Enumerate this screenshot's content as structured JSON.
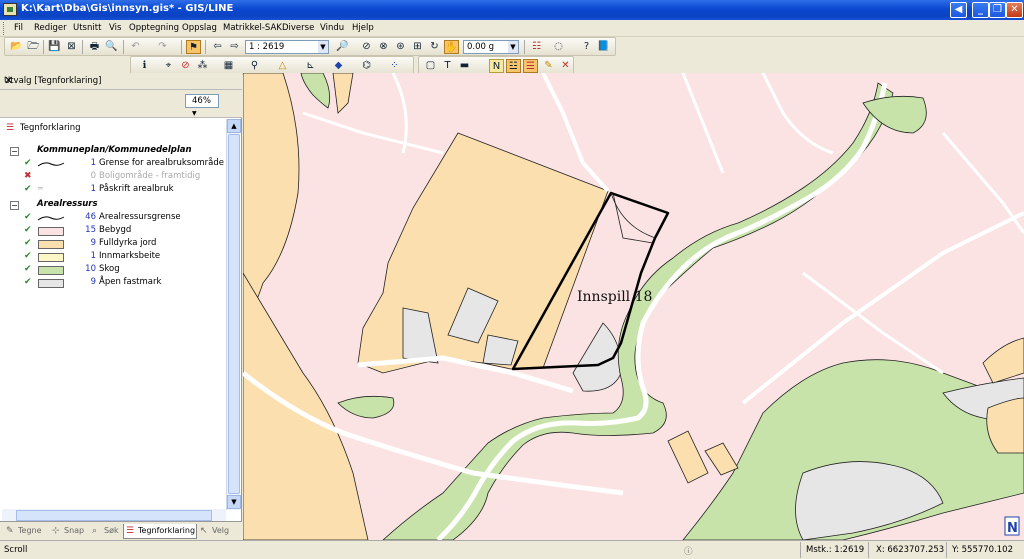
{
  "window": {
    "title": "K:\\Kart\\Dba\\Gis\\innsyn.gis* - GIS/LINE"
  },
  "menu": [
    "Fil",
    "Rediger",
    "Utsnitt",
    "Vis",
    "Opptegning",
    "Oppslag",
    "Matrikkel-SAK",
    "Diverse",
    "Vindu",
    "Hjelp"
  ],
  "toolbar": {
    "scale": "1 : 2619",
    "angle": "0.00 g"
  },
  "panel": {
    "title": "Utvalg [Tegnforklaring]",
    "zoom": "46%",
    "root_label": "Tegnforklaring"
  },
  "legend": {
    "groups": [
      {
        "name": "Kommuneplan/Kommunedelplan",
        "items": [
          {
            "count": "1",
            "label": "Grense for arealbruksområde",
            "swatch": "line",
            "visible": true
          },
          {
            "count": "0",
            "label": "Boligområde - framtidig",
            "swatch": "none",
            "visible": false
          },
          {
            "count": "1",
            "label": "Påskrift arealbruk",
            "swatch": "text",
            "visible": true
          }
        ]
      },
      {
        "name": "Arealressurs",
        "items": [
          {
            "count": "46",
            "label": "Arealressursgrense",
            "swatch": "line",
            "visible": true
          },
          {
            "count": "15",
            "label": "Bebygd",
            "swatch": "#fbe3e3",
            "visible": true
          },
          {
            "count": "9",
            "label": "Fulldyrka jord",
            "swatch": "#fbdfae",
            "visible": true
          },
          {
            "count": "1",
            "label": "Innmarksbeite",
            "swatch": "#fdf6c6",
            "visible": true
          },
          {
            "count": "10",
            "label": "Skog",
            "swatch": "#c8e3a9",
            "visible": true
          },
          {
            "count": "9",
            "label": "Åpen fastmark",
            "swatch": "#e6e6e6",
            "visible": true
          }
        ]
      }
    ]
  },
  "tabs": [
    {
      "label": "Tegne",
      "active": false
    },
    {
      "label": "Snap",
      "active": false
    },
    {
      "label": "Søk",
      "active": false
    },
    {
      "label": "Tegnforklaring",
      "active": true
    },
    {
      "label": "Velg",
      "active": false
    }
  ],
  "map": {
    "annotation": "Innspill 18",
    "colors": {
      "bebygd": "#fbe3e3",
      "fulldyrka": "#fbdfae",
      "skog": "#c8e3a9",
      "aapen": "#e6e6e6"
    }
  },
  "status": {
    "mode": "Scroll",
    "scale": "Mstk.: 1:2619",
    "x": "X: 6623707.253",
    "y": "Y: 555770.102"
  }
}
